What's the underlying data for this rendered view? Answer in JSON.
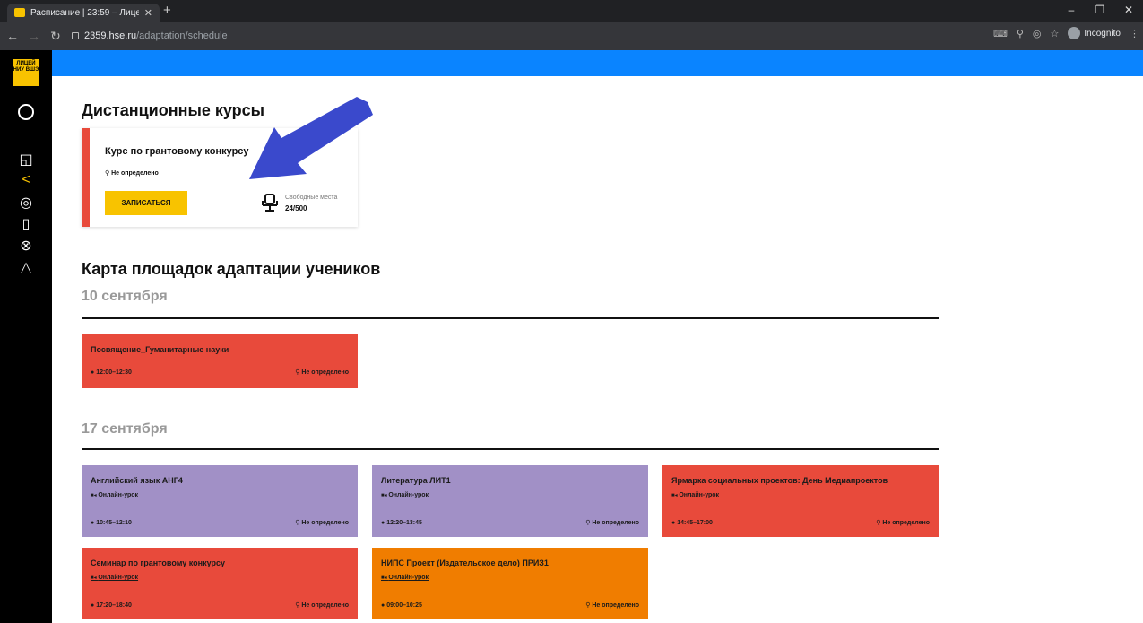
{
  "browser": {
    "tab_title": "Расписание | 23:59 – Лицей НИ",
    "url_host": "2359.hse.ru",
    "url_path": "/adaptation/schedule",
    "incognito_label": "Incognito"
  },
  "sidebar": {
    "logo_text": "ЛИЦЕЙ НИУ ВШЭ"
  },
  "courses": {
    "title": "Дистанционные курсы",
    "card": {
      "name": "Курс по грантовому конкурсу",
      "location": "Не определено",
      "button": "ЗАПИСАТЬСЯ",
      "seats_label": "Свободные места",
      "seats_value": "24/500"
    }
  },
  "map_title": "Карта площадок адаптации учеников",
  "days": [
    {
      "date": "10 сентября",
      "events": [
        {
          "title": "Посвящение_Гуманитарные науки",
          "link": "",
          "time": "12:00–12:30",
          "place": "Не определено",
          "color": "#e84a3b"
        }
      ]
    },
    {
      "date": "17 сентября",
      "events": [
        {
          "title": "Английский язык АНГ4",
          "link": "Онлайн-урок",
          "time": "10:45–12:10",
          "place": "Не определено",
          "color": "#a190c6"
        },
        {
          "title": "Литература ЛИТ1",
          "link": "Онлайн-урок",
          "time": "12:20–13:45",
          "place": "Не определено",
          "color": "#a190c6"
        },
        {
          "title": "Ярмарка социальных проектов: День Медиапроектов",
          "link": "Онлайн-урок",
          "time": "14:45–17:00",
          "place": "Не определено",
          "color": "#e84a3b"
        },
        {
          "title": "Семинар по грантовому конкурсу",
          "link": "Онлайн-урок",
          "time": "17:20–18:40",
          "place": "Не определено",
          "color": "#e84a3b"
        },
        {
          "title": "НИПС Проект (Издательское дело) ПРИЗ1",
          "link": "Онлайн-урок",
          "time": "09:00–10:25",
          "place": "Не определено",
          "color": "#f07d00"
        }
      ]
    }
  ]
}
